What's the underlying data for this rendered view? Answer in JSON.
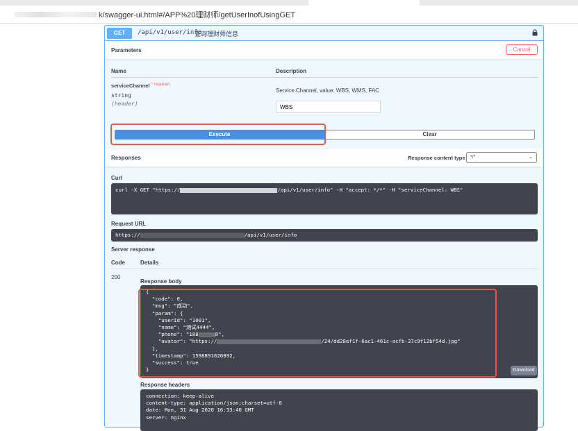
{
  "browser": {
    "url": "k/swagger-ui.html#/APP%20理财师/getUserInofUsingGET"
  },
  "operation": {
    "method": "GET",
    "path": "/api/v1/user/info",
    "summary": "查询理财师信息"
  },
  "parameters": {
    "title": "Parameters",
    "cancel_label": "Cancel",
    "col_name": "Name",
    "col_description": "Description",
    "param_name": "serviceChannel",
    "required_mark": "*",
    "required_label": "required",
    "param_type": "string",
    "param_in": "(header)",
    "param_description": "Service Channel, value: WBS, WMS, FAC",
    "param_value": "WBS"
  },
  "actions": {
    "execute_label": "Execute",
    "clear_label": "Clear"
  },
  "responses": {
    "title": "Responses",
    "content_type_label": "Response content type",
    "content_type_value": "*/*",
    "curl_label": "Curl",
    "curl_prefix": "curl -X GET \"https://",
    "curl_suffix": "/api/v1/user/info\" -H \"accept: */*\" -H \"serviceChannel: WBS\"",
    "request_url_label": "Request URL",
    "request_url_prefix": "https://",
    "request_url_suffix": "/api/v1/user/info",
    "server_response_label": "Server response",
    "col_code": "Code",
    "col_details": "Details",
    "status_code": "200",
    "body_label": "Response body",
    "body_lines": [
      "{",
      "  \"code\": 0,",
      "  \"msg\": \"成功\",",
      "  \"param\": {",
      "    \"userId\": \"1001\",",
      "    \"name\": \"测试4444\",",
      "    \"phone\": \"188",
      "    \"avatar\": \"https://",
      "  },",
      "  \"timestamp\": 1598891620892,",
      "  \"success\": true",
      "}"
    ],
    "phone_tail": "8\",",
    "avatar_tail": "/24/dd28ef1f-6ac1-461c-acfb-37c9f12bf54d.jpg\"",
    "download_label": "Download",
    "headers_label": "Response headers",
    "header_lines": [
      "connection: keep-alive",
      "content-type: application/json;charset=utf-8",
      "date: Mon, 31 Aug 2020 16:33:40 GMT",
      "server: nginx"
    ]
  },
  "colors": {
    "get_blue": "#61affe",
    "execute_blue": "#4990e2",
    "cancel_red": "#ff6060",
    "highlight_red": "#e15a45",
    "code_bg": "#41444e"
  },
  "icons": {
    "lock": "lock-icon",
    "chevron": "chevron-down-icon"
  }
}
